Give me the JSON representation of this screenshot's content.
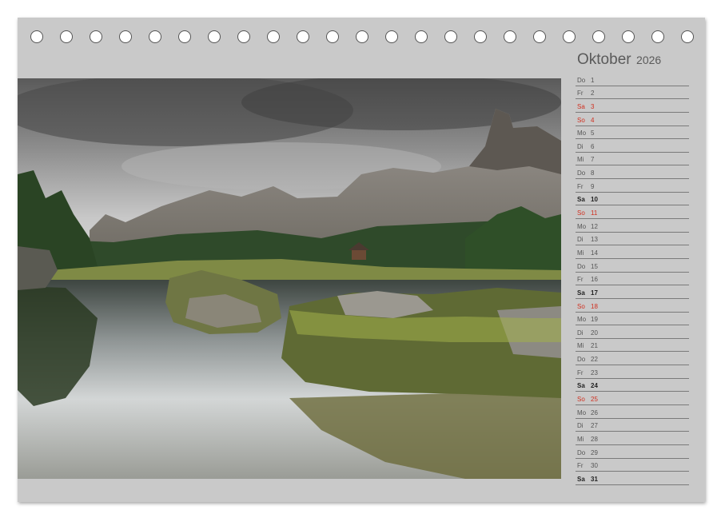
{
  "header": {
    "month": "Oktober",
    "year": "2026"
  },
  "binding": {
    "ring_count": 23
  },
  "photo": {
    "subject": "mountain-lake-landscape"
  },
  "colors": {
    "weekday": "#555555",
    "saturday": "#222222",
    "sunday": "#d03020",
    "page_bg": "#c9c9c9"
  },
  "days": [
    {
      "wd": "Do",
      "d": "1",
      "type": "weekday"
    },
    {
      "wd": "Fr",
      "d": "2",
      "type": "weekday"
    },
    {
      "wd": "Sa",
      "d": "3",
      "type": "sunday"
    },
    {
      "wd": "So",
      "d": "4",
      "type": "sunday"
    },
    {
      "wd": "Mo",
      "d": "5",
      "type": "weekday"
    },
    {
      "wd": "Di",
      "d": "6",
      "type": "weekday"
    },
    {
      "wd": "Mi",
      "d": "7",
      "type": "weekday"
    },
    {
      "wd": "Do",
      "d": "8",
      "type": "weekday"
    },
    {
      "wd": "Fr",
      "d": "9",
      "type": "weekday"
    },
    {
      "wd": "Sa",
      "d": "10",
      "type": "saturday"
    },
    {
      "wd": "So",
      "d": "11",
      "type": "sunday"
    },
    {
      "wd": "Mo",
      "d": "12",
      "type": "weekday"
    },
    {
      "wd": "Di",
      "d": "13",
      "type": "weekday"
    },
    {
      "wd": "Mi",
      "d": "14",
      "type": "weekday"
    },
    {
      "wd": "Do",
      "d": "15",
      "type": "weekday"
    },
    {
      "wd": "Fr",
      "d": "16",
      "type": "weekday"
    },
    {
      "wd": "Sa",
      "d": "17",
      "type": "saturday"
    },
    {
      "wd": "So",
      "d": "18",
      "type": "sunday"
    },
    {
      "wd": "Mo",
      "d": "19",
      "type": "weekday"
    },
    {
      "wd": "Di",
      "d": "20",
      "type": "weekday"
    },
    {
      "wd": "Mi",
      "d": "21",
      "type": "weekday"
    },
    {
      "wd": "Do",
      "d": "22",
      "type": "weekday"
    },
    {
      "wd": "Fr",
      "d": "23",
      "type": "weekday"
    },
    {
      "wd": "Sa",
      "d": "24",
      "type": "saturday"
    },
    {
      "wd": "So",
      "d": "25",
      "type": "sunday"
    },
    {
      "wd": "Mo",
      "d": "26",
      "type": "weekday"
    },
    {
      "wd": "Di",
      "d": "27",
      "type": "weekday"
    },
    {
      "wd": "Mi",
      "d": "28",
      "type": "weekday"
    },
    {
      "wd": "Do",
      "d": "29",
      "type": "weekday"
    },
    {
      "wd": "Fr",
      "d": "30",
      "type": "weekday"
    },
    {
      "wd": "Sa",
      "d": "31",
      "type": "saturday"
    }
  ]
}
